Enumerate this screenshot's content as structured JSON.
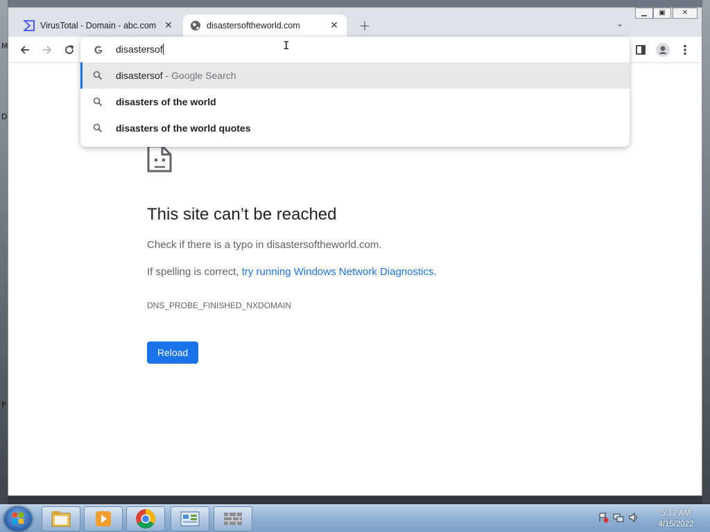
{
  "browser": {
    "tabs": [
      {
        "title": "VirusTotal - Domain - abc.com",
        "icon": "virustotal-icon",
        "active": false
      },
      {
        "title": "disastersoftheworld.com",
        "icon": "globe-icon",
        "active": true
      }
    ],
    "new_tab_label": "+",
    "omnibox": {
      "typed_text": "disastersof",
      "suggestions": [
        {
          "text": "disastersof",
          "suffix": " - Google Search",
          "selected": true
        },
        {
          "text": "disasters of the world",
          "suffix": "",
          "selected": false
        },
        {
          "text": "disasters of the world quotes",
          "suffix": "",
          "selected": false
        }
      ]
    }
  },
  "error_page": {
    "title": "This site can’t be reached",
    "line1": "Check if there is a typo in disastersoftheworld.com.",
    "line2_prefix": "If spelling is correct, ",
    "line2_link": "try running Windows Network Diagnostics",
    "line2_suffix": ".",
    "code": "DNS_PROBE_FINISHED_NXDOMAIN",
    "reload_label": "Reload"
  },
  "desktop": {
    "edge_letters": [
      "M",
      "D",
      "P"
    ]
  },
  "taskbar": {
    "clock_time": "5:12 AM",
    "clock_date": "4/15/2022",
    "pinned": [
      "explorer-icon",
      "media-player-icon",
      "chrome-icon",
      "control-panel-icon",
      "firewall-icon"
    ]
  },
  "colors": {
    "accent": "#1a73e8",
    "text": "#202124",
    "muted": "#5f6368"
  }
}
